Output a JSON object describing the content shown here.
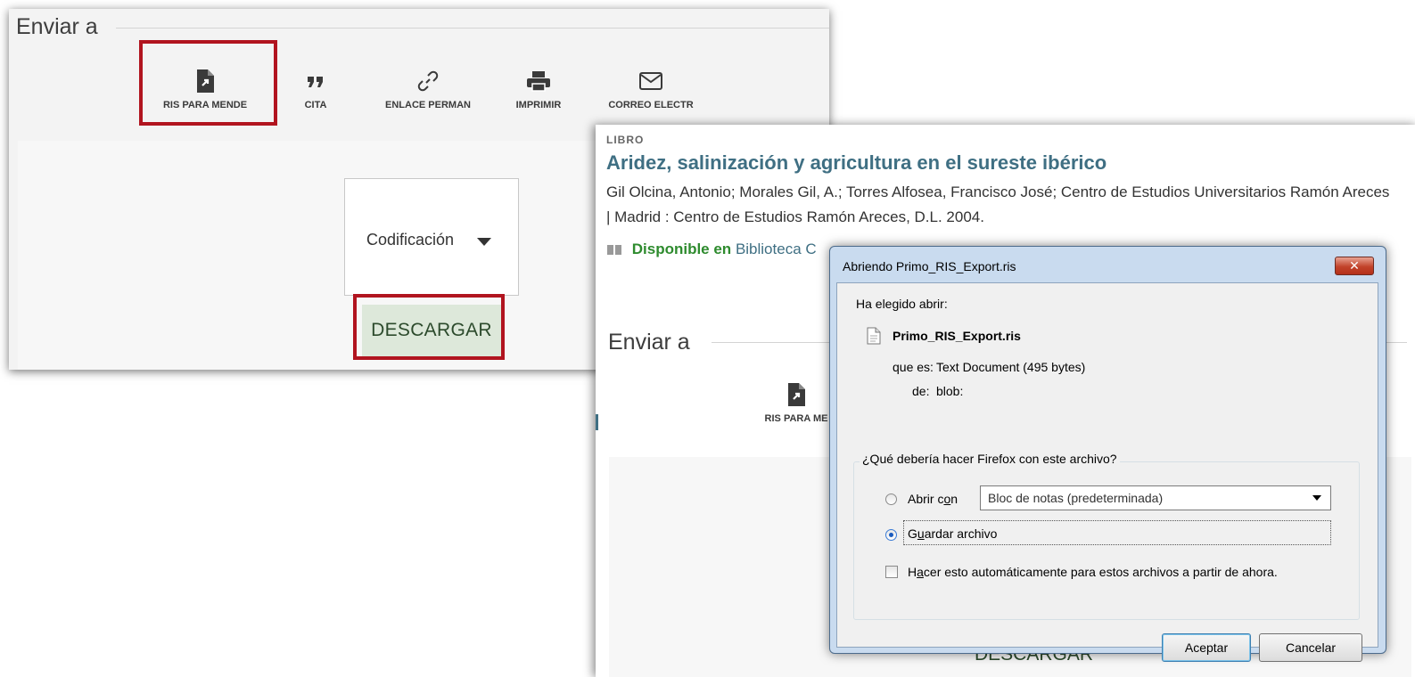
{
  "panel1": {
    "send_to_title": "Enviar a",
    "actions": [
      {
        "label": "RIS PARA MENDE",
        "icon": "ris-file-icon"
      },
      {
        "label": "CITA",
        "icon": "quote-icon"
      },
      {
        "label": "ENLACE PERMAN",
        "icon": "link-icon"
      },
      {
        "label": "IMPRIMIR",
        "icon": "printer-icon"
      },
      {
        "label": "CORREO ELECTR",
        "icon": "envelope-icon"
      }
    ],
    "encoding_label": "Codificación",
    "download_label": "DESCARGAR",
    "highlight_color": "#b1141f"
  },
  "panel2": {
    "type_label": "LIBRO",
    "title": "Aridez, salinización y agricultura en el sureste ibérico",
    "authors": "Gil Olcina, Antonio; Morales Gil, A.; Torres Alfosea, Francisco José; Centro de Estudios Universitarios Ramón Areces | Madrid : Centro de Estudios Ramón Areces, D.L. 2004.",
    "availability_status": "Disponible en",
    "availability_location": "Biblioteca C",
    "send_to_title": "Enviar a",
    "ris_label": "RIS PARA ME",
    "download_label": "DESCARGAR",
    "title_color": "#3f6f83",
    "status_color": "#2e8b2e"
  },
  "dialog": {
    "title": "Abriendo Primo_RIS_Export.ris",
    "close_label": "✕",
    "chosen_to_open": "Ha elegido abrir:",
    "filename": "Primo_RIS_Export.ris",
    "type_key": "que es:",
    "type_value": "Text Document (495 bytes)",
    "from_key": "de:",
    "from_value": "blob:",
    "question": "¿Qué debería hacer Firefox con este archivo?",
    "open_with_pre": "Abrir c",
    "open_with_u": "o",
    "open_with_post": "n",
    "open_with_app": "Bloc de notas (predeterminada)",
    "save_pre": "G",
    "save_u": "u",
    "save_post": "ardar archivo",
    "auto_pre": "H",
    "auto_u": "a",
    "auto_post": "cer esto automáticamente para estos archivos a partir de ahora.",
    "selected_option": "save",
    "auto_checked": false,
    "accept_label": "Aceptar",
    "cancel_label": "Cancelar"
  }
}
